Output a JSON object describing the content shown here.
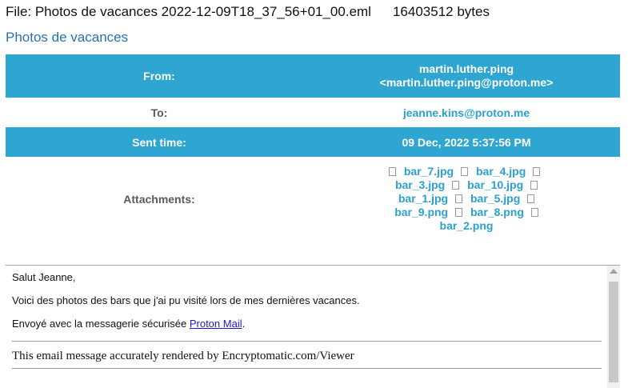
{
  "file": {
    "label": "File: Photos de vacances 2022-12-09T18_37_56+01_00.eml",
    "size": "16403512 bytes"
  },
  "subject": "Photos de vacances",
  "headers": {
    "from_label": "From:",
    "from_name": "martin.luther.ping",
    "from_email": "<martin.luther.ping@proton.me>",
    "to_label": "To:",
    "to_value": "jeanne.kins@proton.me",
    "sent_label": "Sent time:",
    "sent_value": "09 Dec, 2022 5:37:56 PM",
    "attachments_label": "Attachments:"
  },
  "attachments": {
    "icon": "file-icon",
    "rows": [
      [
        "bar_7.jpg",
        "bar_4.jpg"
      ],
      [
        "bar_3.jpg",
        "bar_10.jpg"
      ],
      [
        "bar_1.jpg",
        "bar_5.jpg"
      ],
      [
        "bar_9.png",
        "bar_8.png"
      ],
      [
        "bar_2.png"
      ]
    ]
  },
  "body": {
    "greeting": "Salut Jeanne,",
    "line1": "Voici des photos des bars que j'ai pu visité lors de mes dernières vacances.",
    "line2_prefix": "Envoyé avec la messagerie sécurisée ",
    "line2_link": "Proton Mail",
    "line2_suffix": ".",
    "footer": "This email message accurately rendered by Encryptomatic.com/Viewer"
  },
  "colors": {
    "header_bg": "#2fa5d2",
    "link": "#2ca0d0",
    "subject": "#2a72b0"
  }
}
